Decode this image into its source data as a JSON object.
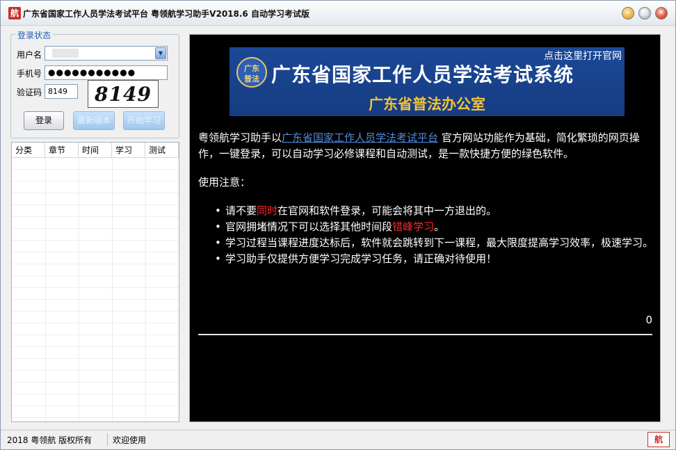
{
  "window": {
    "app_icon": "航",
    "title": "广东省国家工作人员学法考试平台 粤领航学习助手V2018.6 自动学习考试版"
  },
  "login": {
    "group_title": "登录状态",
    "username_label": "用户名",
    "phone_label": "手机号",
    "phone_value": "●●●●●●●●●●●",
    "captcha_label": "验证码",
    "captcha_input": "8149",
    "captcha_image_text": "8149",
    "login_button": "登录",
    "latest_button": "最新版本",
    "start_button": "开始学习"
  },
  "table": {
    "columns": [
      "分类",
      "章节",
      "时间",
      "学习",
      "测试"
    ],
    "rows": []
  },
  "banner": {
    "link_text": "点击这里打开官网",
    "seal_top": "广东",
    "seal_bottom": "普法",
    "title": "广东省国家工作人员学法考试系统",
    "subtitle": "广东省普法办公室"
  },
  "content": {
    "intro_prefix": "粤领航学习助手以",
    "intro_link": "广东省国家工作人员学法考试平台",
    "intro_suffix": " 官方网站功能作为基础，简化繁琐的网页操作，一键登录，可以自动学习必修课程和自动测试，是一款快捷方便的绿色软件。",
    "notes_title": "使用注意：",
    "note1_a": "请不要",
    "note1_red": "同时",
    "note1_b": "在官网和软件登录，可能会将其中一方退出的。",
    "note2_a": "官网拥堵情况下可以选择其他时间段",
    "note2_red": "错峰学习",
    "note2_b": "。",
    "note3": "学习过程当课程进度达标后，软件就会跳转到下一课程，最大限度提高学习效率，极速学习。",
    "note4": "学习助手仅提供方便学习完成学习任务，请正确对待使用！",
    "progress_value": "0"
  },
  "status": {
    "copyright": "2018 粤领航 版权所有",
    "welcome": "欢迎使用",
    "logo": "航"
  },
  "colors": {
    "link": "#4f8de0",
    "highlight_red": "#ff2a2a",
    "banner_blue": "#1b4896",
    "banner_gold": "#f0c33a"
  }
}
